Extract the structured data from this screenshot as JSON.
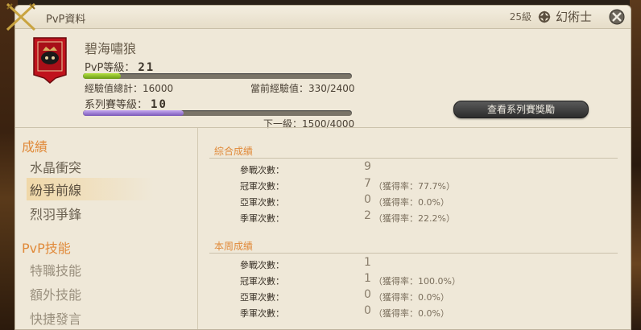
{
  "window": {
    "title": "PvP資料",
    "level": "25級",
    "job": "幻術士"
  },
  "player": {
    "name": "碧海嘯狼",
    "pvp_rank_label": "PvP等級：",
    "pvp_rank": "21",
    "pvp_bar_progress": 0.14,
    "exp_total": "經驗值總計：16000",
    "exp_current": "當前經驗值：330/2400",
    "series_rank_label": "系列賽等級：",
    "series_rank": "10",
    "series_bar_progress": 0.375,
    "next_level": "下一級：1500/4000",
    "series_reward_button": "查看系列賽獎勵"
  },
  "colors": {
    "accent_orange": "#e08a3a",
    "pvp_bar": "#8ab82a",
    "series_bar": "#9a7ad0"
  },
  "sidebar": {
    "record_heading": "成績",
    "record_items": [
      "水晶衝突",
      "紛爭前線",
      "烈羽爭鋒"
    ],
    "active_item": "紛爭前線",
    "skills_heading": "PvP技能",
    "skill_items": [
      "特職技能",
      "額外技能",
      "快捷發言"
    ]
  },
  "overall": {
    "heading": "綜合成績",
    "rows": [
      {
        "label": "參戰次數：",
        "value": "9",
        "rate": ""
      },
      {
        "label": "冠軍次數：",
        "value": "7",
        "rate": "（獲得率：77.7%）"
      },
      {
        "label": "亞軍次數：",
        "value": "0",
        "rate": "（獲得率：0.0%）"
      },
      {
        "label": "季軍次數：",
        "value": "2",
        "rate": "（獲得率：22.2%）"
      }
    ]
  },
  "weekly": {
    "heading": "本周成績",
    "rows": [
      {
        "label": "參戰次數：",
        "value": "1",
        "rate": ""
      },
      {
        "label": "冠軍次數：",
        "value": "1",
        "rate": "（獲得率：100.0%）"
      },
      {
        "label": "亞軍次數：",
        "value": "0",
        "rate": "（獲得率：0.0%）"
      },
      {
        "label": "季軍次數：",
        "value": "0",
        "rate": "（獲得率：0.0%）"
      }
    ]
  },
  "icons": [
    "crossed-swords-icon",
    "class-emblem-icon",
    "close-icon",
    "grand-company-emblem-icon"
  ]
}
